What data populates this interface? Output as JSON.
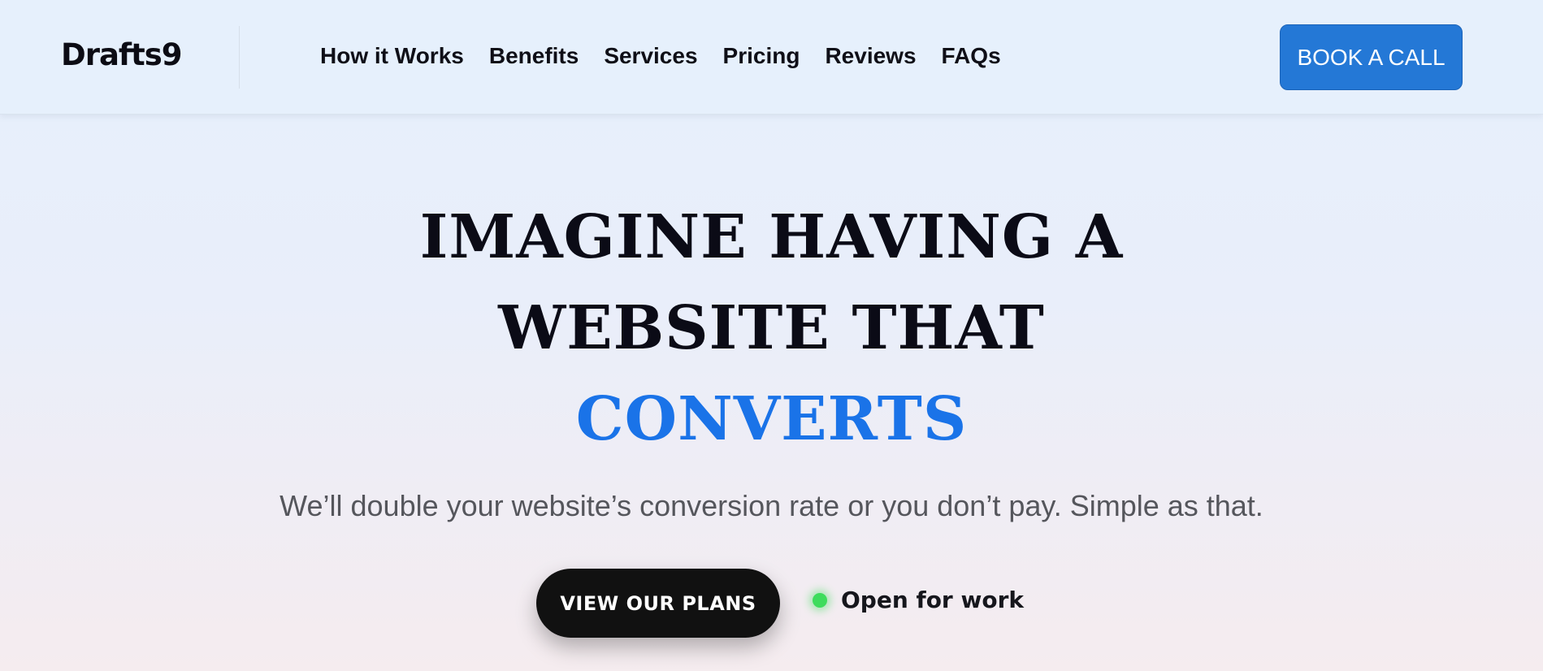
{
  "header": {
    "logo": "Drafts9",
    "nav": [
      {
        "label": "How it Works"
      },
      {
        "label": "Benefits"
      },
      {
        "label": "Services"
      },
      {
        "label": "Pricing"
      },
      {
        "label": "Reviews"
      },
      {
        "label": "FAQs"
      }
    ],
    "cta_label": "BOOK A CALL"
  },
  "hero": {
    "line1": "IMAGINE HAVING A",
    "line2": "WEBSITE THAT",
    "line3_accent": "CONVERTS",
    "subtitle": "We’ll double your website’s conversion rate or you don’t pay. Simple as that.",
    "cta_label": "VIEW OUR PLANS",
    "status_label": "Open for work"
  },
  "colors": {
    "accent": "#1a73e8",
    "button_blue": "#2478d6",
    "cta_black": "#111111",
    "status_green": "#3ddc5c"
  },
  "icons": {
    "status": "status-dot-icon"
  }
}
